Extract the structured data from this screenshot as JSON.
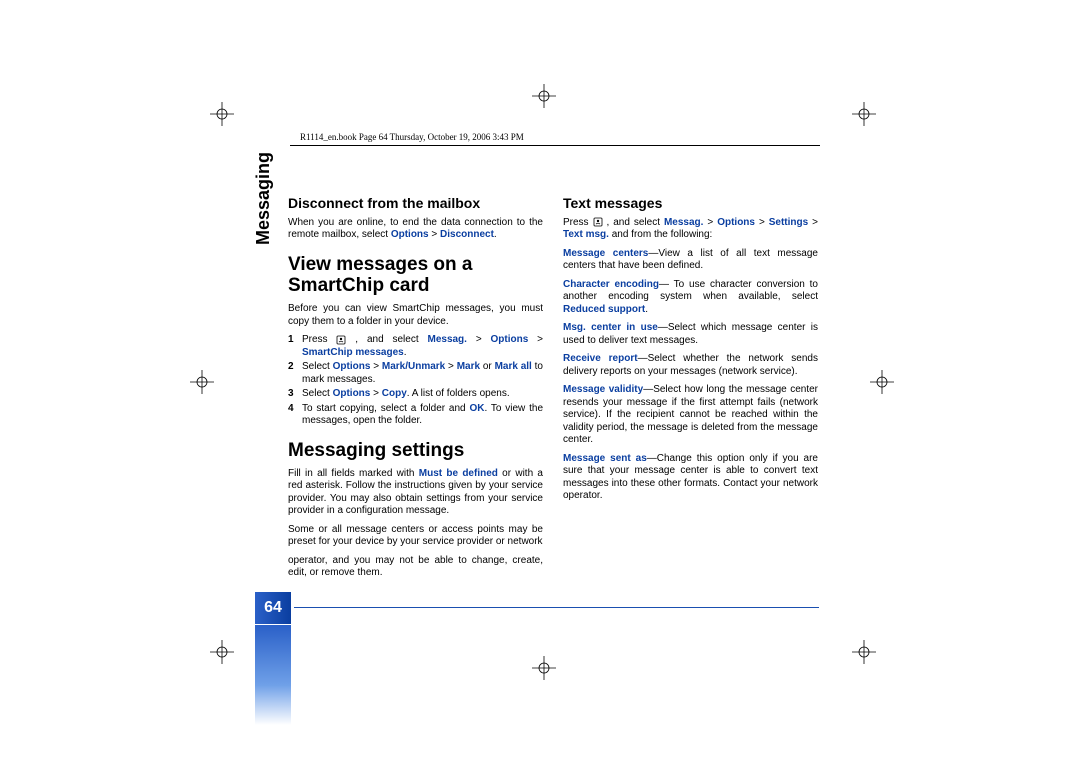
{
  "header": "R1114_en.book  Page 64  Thursday, October 19, 2006  3:43 PM",
  "side_tab": "Messaging",
  "page_number": "64",
  "col1": {
    "h_disconnect": "Disconnect from the mailbox",
    "p_disconnect_a": "When you are online, to end the data connection to the remote mailbox, select ",
    "opt": "Options",
    "gt": " > ",
    "disc": "Disconnect",
    "h_view": "View messages on a SmartChip card",
    "p_view": "Before you can view SmartChip messages, you must copy them to a folder in your device.",
    "s1a": "Press ",
    "s1b": " , and select ",
    "s1_messag": "Messag.",
    "s1_sc": "SmartChip messages",
    "s2a": "Select ",
    "s2_mu": "Mark/Unmark",
    "s2_mark": "Mark",
    "s2_or": " or ",
    "s2_markall": "Mark all",
    "s2b": " to mark messages.",
    "s3a": "Select ",
    "s3_copy": "Copy",
    "s3b": ". A list of folders opens.",
    "s4a": "To start copying, select a folder and ",
    "s4_ok": "OK",
    "s4b": ". To view the messages, open the folder.",
    "h_settings": "Messaging settings",
    "p_set_a": "Fill in all fields marked with ",
    "p_set_must": "Must be defined",
    "p_set_b": " or with a red asterisk. Follow the instructions given by your service provider. You may also obtain settings from your service provider in a configuration message.",
    "p_set2": "Some or all message centers or access points may be preset for your device by your service provider or network"
  },
  "col2": {
    "p_top": "operator, and you may not be able to change, create, edit, or remove them.",
    "h_text": "Text messages",
    "p1a": "Press ",
    "p1b": " , and select ",
    "p1_messag": "Messag.",
    "p1_set": "Settings",
    "p1_txt": "Text msg.",
    "p1c": " and from the following:",
    "mc": "Message centers",
    "mc_t": "—View a list of all text message centers that have been defined.",
    "ce": "Character encoding",
    "ce_t": "— To use character conversion to another encoding system when available, select ",
    "ce_r": "Reduced support",
    "mciu": "Msg. center in use",
    "mciu_t": "—Select which message center is used to deliver text messages.",
    "rr": "Receive report",
    "rr_t": "—Select whether the network sends delivery reports on your messages (network service).",
    "mv": "Message validity",
    "mv_t": "—Select how long the message center resends your message if the first attempt fails (network service). If the recipient cannot be reached within the validity period, the message is deleted from the message center.",
    "msa": "Message sent as",
    "msa_t": "—Change this option only if you are sure that your message center is able to convert text messages into these other formats. Contact your network operator."
  }
}
